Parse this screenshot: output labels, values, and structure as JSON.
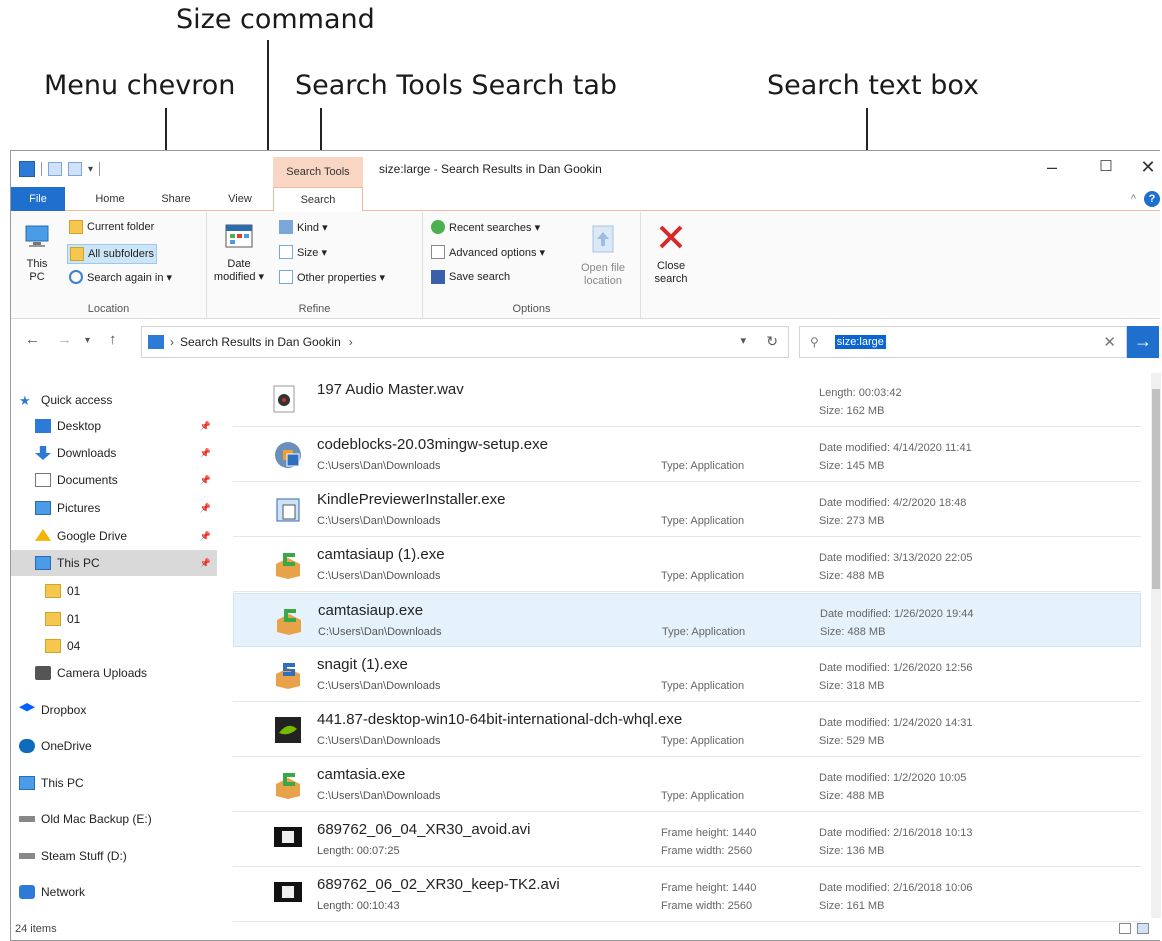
{
  "callouts": {
    "size_command": "Size command",
    "menu_chevron": "Menu chevron",
    "search_tab": "Search Tools Search tab",
    "search_box": "Search text box"
  },
  "window": {
    "context_tab": "Search Tools",
    "title": "size:large - Search Results in Dan Gookin"
  },
  "tabs": {
    "file": "File",
    "home": "Home",
    "share": "Share",
    "view": "View",
    "search": "Search"
  },
  "ribbon": {
    "location": {
      "this_pc": [
        "This",
        "PC"
      ],
      "current_folder": "Current folder",
      "all_subfolders": "All subfolders",
      "search_again": "Search again in ▾",
      "label": "Location"
    },
    "refine": {
      "date_modified": [
        "Date",
        "modified ▾"
      ],
      "kind": "Kind ▾",
      "size": "Size ▾",
      "other_properties": "Other properties ▾",
      "label": "Refine"
    },
    "options": {
      "recent_searches": "Recent searches ▾",
      "advanced_options": "Advanced options ▾",
      "save_search": "Save search",
      "open_file_location": [
        "Open file",
        "location"
      ],
      "label": "Options"
    },
    "close": {
      "label": [
        "Close",
        "search"
      ]
    }
  },
  "address": {
    "path": "Search Results in Dan Gookin",
    "sep": "›"
  },
  "search": {
    "query": "size:large"
  },
  "navpane": [
    {
      "label": "Quick access",
      "icon": "star-icon",
      "pin": false
    },
    {
      "label": "Desktop",
      "icon": "desktop-icon",
      "pin": true
    },
    {
      "label": "Downloads",
      "icon": "download-icon",
      "pin": true
    },
    {
      "label": "Documents",
      "icon": "document-icon",
      "pin": true
    },
    {
      "label": "Pictures",
      "icon": "pictures-icon",
      "pin": true
    },
    {
      "label": "Google Drive",
      "icon": "google-drive-icon",
      "pin": true
    },
    {
      "label": "This PC",
      "icon": "monitor-icon",
      "pin": true
    },
    {
      "label": "01",
      "icon": "folder-icon",
      "pin": false
    },
    {
      "label": "01",
      "icon": "folder-icon",
      "pin": false
    },
    {
      "label": "04",
      "icon": "folder-icon",
      "pin": false
    },
    {
      "label": "Camera Uploads",
      "icon": "camera-icon",
      "pin": false
    },
    {
      "label": "Dropbox",
      "icon": "dropbox-icon",
      "pin": false
    },
    {
      "label": "OneDrive",
      "icon": "cloud-icon",
      "pin": false
    },
    {
      "label": "This PC",
      "icon": "monitor-icon",
      "pin": false
    },
    {
      "label": "Old Mac Backup (E:)",
      "icon": "drive-icon",
      "pin": false
    },
    {
      "label": "Steam Stuff (D:)",
      "icon": "drive-icon",
      "pin": false
    },
    {
      "label": "Network",
      "icon": "network-icon",
      "pin": false
    }
  ],
  "results": [
    {
      "name": "197 Audio Master.wav",
      "path": "",
      "mid1": "",
      "mid2": "",
      "r1": "Length: 00:03:42",
      "r2": "Size: 162 MB"
    },
    {
      "name": "codeblocks-20.03mingw-setup.exe",
      "path": "C:\\Users\\Dan\\Downloads",
      "mid1": "",
      "mid2": "Type: Application",
      "r1": "Date modified: 4/14/2020 11:41",
      "r2": "Size: 145 MB"
    },
    {
      "name": "KindlePreviewerInstaller.exe",
      "path": "C:\\Users\\Dan\\Downloads",
      "mid1": "",
      "mid2": "Type: Application",
      "r1": "Date modified: 4/2/2020 18:48",
      "r2": "Size: 273 MB"
    },
    {
      "name": "camtasiaup (1).exe",
      "path": "C:\\Users\\Dan\\Downloads",
      "mid1": "",
      "mid2": "Type: Application",
      "r1": "Date modified: 3/13/2020 22:05",
      "r2": "Size: 488 MB"
    },
    {
      "name": "camtasiaup.exe",
      "path": "C:\\Users\\Dan\\Downloads",
      "mid1": "",
      "mid2": "Type: Application",
      "r1": "Date modified: 1/26/2020 19:44",
      "r2": "Size: 488 MB"
    },
    {
      "name": "snagit (1).exe",
      "path": "C:\\Users\\Dan\\Downloads",
      "mid1": "",
      "mid2": "Type: Application",
      "r1": "Date modified: 1/26/2020 12:56",
      "r2": "Size: 318 MB"
    },
    {
      "name": "441.87-desktop-win10-64bit-international-dch-whql.exe",
      "path": "C:\\Users\\Dan\\Downloads",
      "mid1": "",
      "mid2": "Type: Application",
      "r1": "Date modified: 1/24/2020 14:31",
      "r2": "Size: 529 MB"
    },
    {
      "name": "camtasia.exe",
      "path": "C:\\Users\\Dan\\Downloads",
      "mid1": "",
      "mid2": "Type: Application",
      "r1": "Date modified: 1/2/2020 10:05",
      "r2": "Size: 488 MB"
    },
    {
      "name": "689762_06_04_XR30_avoid.avi",
      "path": "Length: 00:07:25",
      "mid1": "Frame height: 1440",
      "mid2": "Frame width: 2560",
      "r1": "Date modified: 2/16/2018 10:13",
      "r2": "Size: 136 MB"
    },
    {
      "name": "689762_06_02_XR30_keep-TK2.avi",
      "path": "Length: 00:10:43",
      "mid1": "Frame height: 1440",
      "mid2": "Frame width: 2560",
      "r1": "Date modified: 2/16/2018 10:06",
      "r2": "Size: 161 MB"
    }
  ],
  "status": {
    "items": "24 items"
  },
  "colors": {
    "accent": "#1f6fcf",
    "context_tab": "#f9d6c4",
    "selection": "#e5f1fb",
    "close_red": "#d42a2a"
  }
}
